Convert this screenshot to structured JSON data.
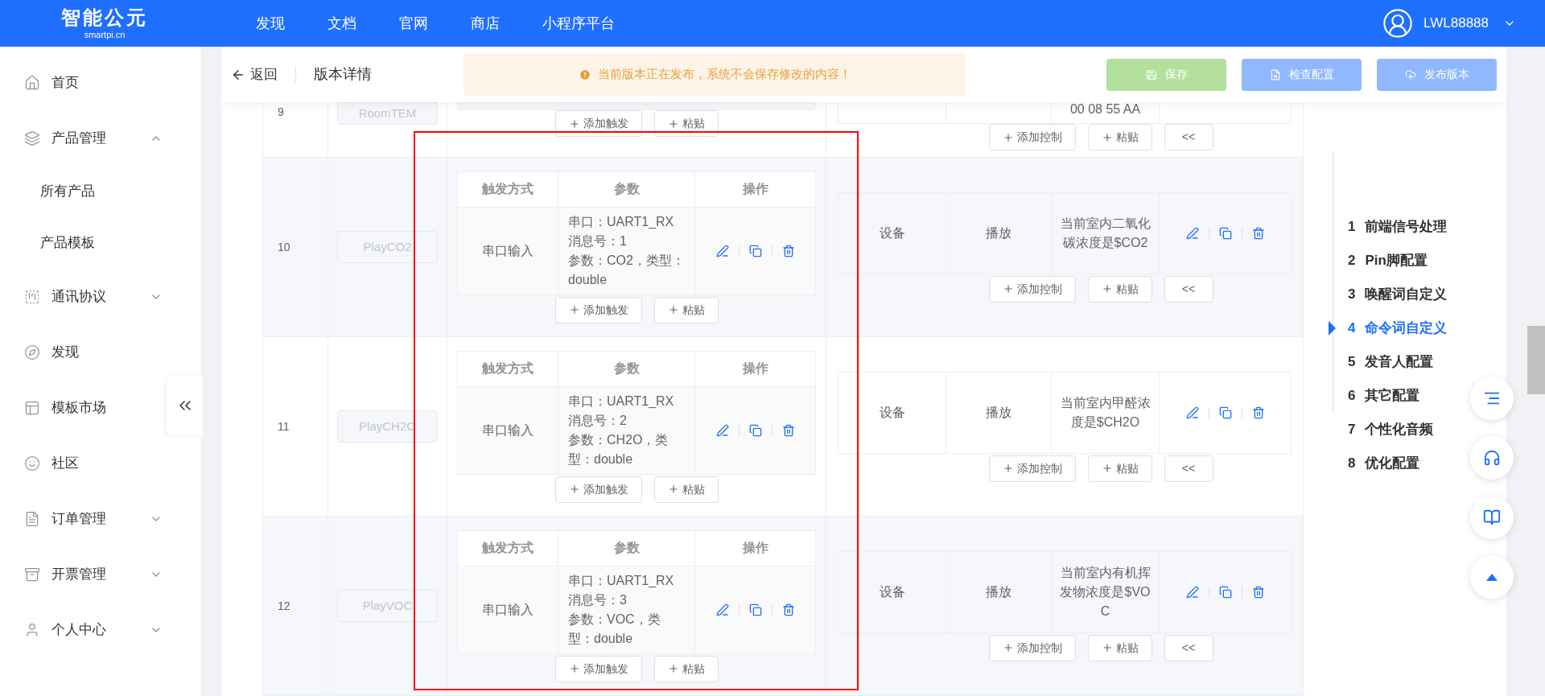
{
  "top_nav": {
    "logo": {
      "title": "智能公元",
      "subtitle": "smartpi.cn"
    },
    "links": [
      "发现",
      "文档",
      "官网",
      "商店",
      "小程序平台"
    ],
    "user": "LWL88888"
  },
  "sidebar": {
    "items": [
      {
        "label": "首页"
      },
      {
        "label": "产品管理",
        "expanded": true,
        "children": [
          {
            "label": "所有产品"
          },
          {
            "label": "产品模板"
          }
        ]
      },
      {
        "label": "通讯协议",
        "expanded": false
      },
      {
        "label": "发现"
      },
      {
        "label": "模板市场"
      },
      {
        "label": "社区"
      },
      {
        "label": "订单管理",
        "expanded": false
      },
      {
        "label": "开票管理",
        "expanded": false
      },
      {
        "label": "个人中心",
        "expanded": false
      }
    ]
  },
  "header": {
    "back": "返回",
    "title": "版本详情",
    "notice": "当前版本正在发布，系统不会保存修改的内容！",
    "buttons": [
      {
        "label": "保存",
        "kind": "save",
        "disabled": true
      },
      {
        "label": "检查配置",
        "kind": "check",
        "disabled": true
      },
      {
        "label": "发布版本",
        "kind": "publish",
        "disabled": true
      }
    ]
  },
  "partial_row": {
    "number": "9",
    "name": "RoomTEM",
    "control_text": "00 08 55 AA",
    "trigger_buttons": [
      "添加触发",
      "粘贴"
    ],
    "control_buttons": [
      "添加控制",
      "粘贴",
      "<<"
    ]
  },
  "rows": [
    {
      "number": "10",
      "name": "PlayCO2",
      "trigger": {
        "columns": [
          "触发方式",
          "参数",
          "操作"
        ],
        "method": "串口输入",
        "params": [
          "串口：UART1_RX",
          "消息号：1",
          "参数：CO2，类型：double"
        ]
      },
      "control": {
        "target": "设备",
        "action": "播放",
        "text": "当前室内二氧化碳浓度是$CO2"
      },
      "trigger_buttons": [
        "添加触发",
        "粘贴"
      ],
      "control_buttons": [
        "添加控制",
        "粘贴",
        "<<"
      ]
    },
    {
      "number": "11",
      "name": "PlayCH2O",
      "trigger": {
        "columns": [
          "触发方式",
          "参数",
          "操作"
        ],
        "method": "串口输入",
        "params": [
          "串口：UART1_RX",
          "消息号：2",
          "参数：CH2O，类型：double"
        ]
      },
      "control": {
        "target": "设备",
        "action": "播放",
        "text": "当前室内甲醛浓度是$CH2O"
      },
      "trigger_buttons": [
        "添加触发",
        "粘贴"
      ],
      "control_buttons": [
        "添加控制",
        "粘贴",
        "<<"
      ]
    },
    {
      "number": "12",
      "name": "PlayVOC",
      "trigger": {
        "columns": [
          "触发方式",
          "参数",
          "操作"
        ],
        "method": "串口输入",
        "params": [
          "串口：UART1_RX",
          "消息号：3",
          "参数：VOC，类型：double"
        ]
      },
      "control": {
        "target": "设备",
        "action": "播放",
        "text": "当前室内有机挥发物浓度是$VOC"
      },
      "trigger_buttons": [
        "添加触发",
        "粘贴"
      ],
      "control_buttons": [
        "添加控制",
        "粘贴",
        "<<"
      ]
    }
  ],
  "steps": [
    {
      "number": "1",
      "label": "前端信号处理",
      "selected": false
    },
    {
      "number": "2",
      "label": "Pin脚配置",
      "selected": false
    },
    {
      "number": "3",
      "label": "唤醒词自定义",
      "selected": false
    },
    {
      "number": "4",
      "label": "命令词自定义",
      "selected": true
    },
    {
      "number": "5",
      "label": "发音人配置",
      "selected": false
    },
    {
      "number": "6",
      "label": "其它配置",
      "selected": false
    },
    {
      "number": "7",
      "label": "个性化音频",
      "selected": false
    },
    {
      "number": "8",
      "label": "优化配置",
      "selected": false
    }
  ]
}
